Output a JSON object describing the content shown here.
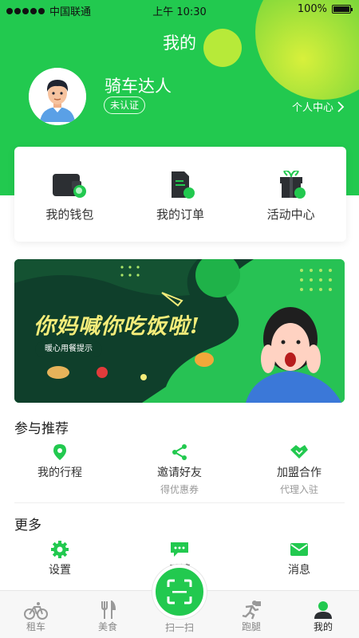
{
  "status": {
    "carrier": "中国联通",
    "time": "上午 10:30",
    "battery": "100%"
  },
  "header": {
    "title": "我的",
    "username": "骑车达人",
    "verify_label": "未认证",
    "center_link": "个人中心"
  },
  "quick": [
    {
      "label": "我的钱包",
      "icon": "wallet-icon"
    },
    {
      "label": "我的订单",
      "icon": "order-icon"
    },
    {
      "label": "活动中心",
      "icon": "gift-icon"
    }
  ],
  "banner": {
    "headline": "你妈喊你吃饭啦!",
    "tag": "暖心用餐提示"
  },
  "recommend": {
    "title": "参与推荐",
    "items": [
      {
        "label": "我的行程",
        "sub": "",
        "icon": "location-pin-icon"
      },
      {
        "label": "邀请好友",
        "sub": "得优惠券",
        "icon": "share-icon"
      },
      {
        "label": "加盟合作",
        "sub": "代理入驻",
        "icon": "handshake-icon"
      }
    ]
  },
  "more": {
    "title": "更多",
    "items": [
      {
        "label": "设置",
        "icon": "gear-icon"
      },
      {
        "label": "反馈",
        "icon": "chat-icon"
      },
      {
        "label": "消息",
        "icon": "mail-icon"
      }
    ]
  },
  "tabs": [
    {
      "label": "租车",
      "icon": "bike-icon"
    },
    {
      "label": "美食",
      "icon": "cutlery-icon"
    },
    {
      "label": "扫一扫",
      "icon": "scan-icon"
    },
    {
      "label": "跑腿",
      "icon": "runner-icon"
    },
    {
      "label": "我的",
      "icon": "user-icon"
    }
  ],
  "colors": {
    "primary": "#22c94f",
    "accent_yellow": "#d8f03b",
    "banner_dark": "#0f3f2b"
  }
}
